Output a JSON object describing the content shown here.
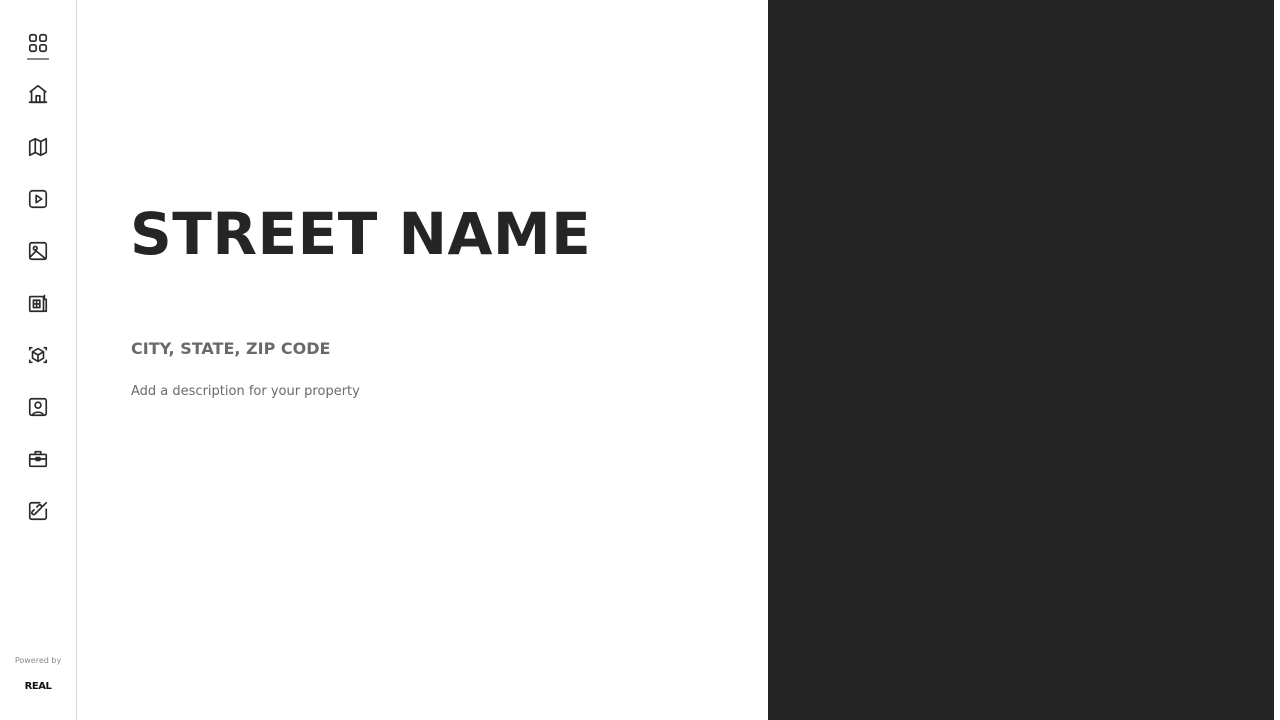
{
  "sidebar": {
    "items": [
      {
        "name": "grid-icon"
      },
      {
        "name": "home-icon"
      },
      {
        "name": "map-icon"
      },
      {
        "name": "video-icon"
      },
      {
        "name": "image-icon"
      },
      {
        "name": "floorplan-icon"
      },
      {
        "name": "cube-3d-icon"
      },
      {
        "name": "contact-icon"
      },
      {
        "name": "briefcase-icon"
      },
      {
        "name": "link-edit-icon"
      }
    ],
    "powered_by": "Powered by",
    "brand": "REAL"
  },
  "property": {
    "street": "STREET NAME",
    "city_state_zip": "CITY, STATE, ZIP CODE",
    "description": "Add a description for your property"
  },
  "colors": {
    "text_dark": "#252525",
    "text_muted": "#6a6a6a",
    "panel_dark": "#242424",
    "divider": "#d9d9d9"
  }
}
